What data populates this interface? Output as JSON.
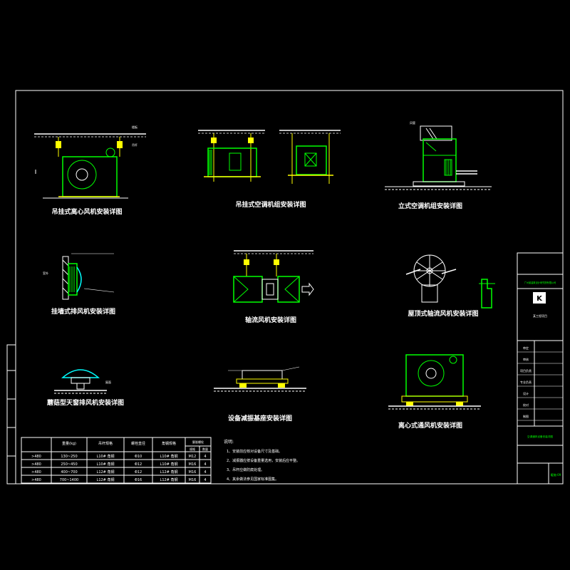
{
  "captions": {
    "c1": "吊挂式离心风机安装详图",
    "c2": "吊挂式空调机组安装详图",
    "c3": "立式空调机组安装详图",
    "c4": "挂墙式排风机安装详图",
    "c5": "轴流风机安装详图",
    "c6": "屋顶式轴流风机安装详图",
    "c7": "蘑菇型天窗排风机安装详图",
    "c8": "设备减振基座安装详图",
    "c9": "离心式通风机安装详图"
  },
  "table": {
    "headers": [
      "",
      "重量(kg)",
      "吊杆规格",
      "螺栓直径",
      "角钢规格",
      "膨胀螺栓"
    ],
    "sub_headers": [
      "规格",
      "数量"
    ],
    "rows": [
      [
        ">480",
        "130~250",
        "L10# 角钢",
        "Φ10",
        "L10# 角钢",
        "M12",
        "4"
      ],
      [
        ">480",
        "250~450",
        "L10# 角钢",
        "Φ12",
        "L10# 角钢",
        "M16",
        "4"
      ],
      [
        ">480",
        "400~700",
        "L12# 角钢",
        "Φ12",
        "L12# 角钢",
        "M16",
        "4"
      ],
      [
        ">480",
        "700~1400",
        "L12# 角钢",
        "Φ16",
        "L12# 角钢",
        "M16",
        "4"
      ]
    ]
  },
  "notes": {
    "title": "说明:",
    "items": [
      "1、安装前应核对设备尺寸及基础。",
      "2、减振器应按设备重量选用，安装后应平整。",
      "3、吊杆应做防腐处理。",
      "4、其余做法参见国家标准图集。"
    ]
  },
  "title_block": {
    "company": "广州某建筑设计研究院有限公司",
    "project": "某工程项目",
    "drawing_title": "空调通风设备安装详图",
    "drawing_no": "暖施-09",
    "rows": [
      "审定",
      "审核",
      "项目负责",
      "专业负责",
      "设计",
      "校对",
      "制图"
    ]
  }
}
